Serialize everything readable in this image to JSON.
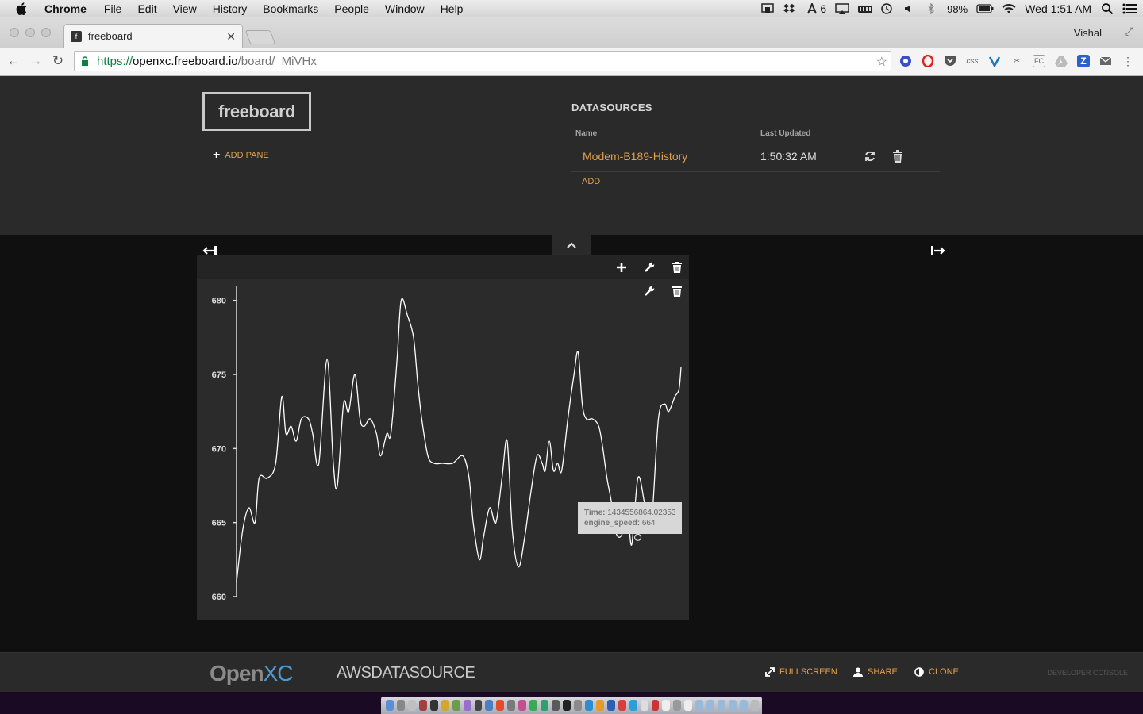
{
  "menubar": {
    "app": "Chrome",
    "items": [
      "File",
      "Edit",
      "View",
      "History",
      "Bookmarks",
      "People",
      "Window",
      "Help"
    ],
    "status_icons": [
      "dropbox-icon",
      "acrobat-icon",
      "airplay-icon",
      "battery-icon",
      "timemachine-icon",
      "volume-icon",
      "bluetooth-icon"
    ],
    "acrobat_count": "6",
    "battery_percent": "98%",
    "clock": "Wed 1:51 AM"
  },
  "browser": {
    "tab_title": "freeboard",
    "profile": "Vishal",
    "url_scheme": "https://",
    "url_host": "openxc.freeboard.io",
    "url_path": "/board/_MiVHx"
  },
  "header": {
    "logo": "freeboard",
    "add_pane": "ADD PANE",
    "datasources_title": "DATASOURCES",
    "col_name": "Name",
    "col_updated": "Last Updated",
    "datasource": {
      "name": "Modem-B189-History",
      "last_updated": "1:50:32 AM"
    },
    "add": "ADD"
  },
  "chart_data": {
    "type": "line",
    "series": [
      {
        "values": [
          [
            0,
            661
          ],
          [
            6,
            664.5
          ],
          [
            12,
            666
          ],
          [
            18,
            665
          ],
          [
            22,
            668
          ],
          [
            30,
            668
          ],
          [
            38,
            669
          ],
          [
            44,
            673.5
          ],
          [
            48,
            671
          ],
          [
            53,
            671.5
          ],
          [
            58,
            670.5
          ],
          [
            63,
            672
          ],
          [
            70,
            672
          ],
          [
            74,
            671
          ],
          [
            80,
            669
          ],
          [
            88,
            676
          ],
          [
            94,
            669
          ],
          [
            98,
            667.5
          ],
          [
            104,
            673
          ],
          [
            109,
            672.5
          ],
          [
            115,
            675
          ],
          [
            120,
            672
          ],
          [
            124,
            671.5
          ],
          [
            130,
            672
          ],
          [
            136,
            671
          ],
          [
            140,
            669.5
          ],
          [
            146,
            671
          ],
          [
            150,
            671
          ],
          [
            156,
            676
          ],
          [
            160,
            680
          ],
          [
            166,
            679
          ],
          [
            172,
            677.5
          ],
          [
            176,
            674.5
          ],
          [
            180,
            672
          ],
          [
            186,
            669.5
          ],
          [
            192,
            669
          ],
          [
            200,
            669
          ],
          [
            210,
            669
          ],
          [
            220,
            669.5
          ],
          [
            226,
            668
          ],
          [
            230,
            665
          ],
          [
            236,
            662.5
          ],
          [
            240,
            664
          ],
          [
            246,
            666
          ],
          [
            252,
            665
          ],
          [
            258,
            668
          ],
          [
            263,
            670.5
          ],
          [
            268,
            664.5
          ],
          [
            274,
            662
          ],
          [
            280,
            664
          ],
          [
            286,
            667
          ],
          [
            292,
            669.5
          ],
          [
            297,
            669
          ],
          [
            300,
            668.5
          ],
          [
            304,
            670.5
          ],
          [
            308,
            668.5
          ],
          [
            312,
            669
          ],
          [
            316,
            668.5
          ],
          [
            322,
            672
          ],
          [
            328,
            675
          ],
          [
            332,
            676.5
          ],
          [
            336,
            673
          ],
          [
            340,
            672
          ],
          [
            346,
            672
          ],
          [
            352,
            671.5
          ],
          [
            356,
            670
          ],
          [
            360,
            668
          ],
          [
            364,
            666.5
          ],
          [
            368,
            664.5
          ],
          [
            372,
            664
          ],
          [
            376,
            664.5
          ],
          [
            380,
            666
          ],
          [
            384,
            663.5
          ],
          [
            390,
            668
          ],
          [
            396,
            666.5
          ],
          [
            400,
            664.5
          ],
          [
            404,
            665.5
          ],
          [
            410,
            672
          ],
          [
            416,
            673
          ],
          [
            420,
            672.5
          ],
          [
            426,
            673.5
          ],
          [
            430,
            674
          ],
          [
            432,
            675.5
          ]
        ]
      }
    ],
    "xlim": [
      0,
      432
    ],
    "ylim": [
      660,
      681
    ],
    "yticks": [
      660,
      665,
      670,
      675,
      680
    ],
    "highlight": {
      "time": "1434556864.02353",
      "engine_speed": "664"
    }
  },
  "tooltip": {
    "time_label": "Time:",
    "time_value": "1434556864.02353",
    "speed_label": "engine_speed:",
    "speed_value": "664"
  },
  "footer": {
    "brand_open": "Open",
    "brand_xc": "XC",
    "board_name": "AWSDATASOURCE",
    "fullscreen": "FULLSCREEN",
    "share": "SHARE",
    "clone": "CLONE",
    "developer_console": "DEVELOPER CONSOLE"
  },
  "colors": {
    "accent": "#e0a04d",
    "header_bg": "#2a2a2a",
    "board_bg": "#101010",
    "pane_bg": "#2b2b2b",
    "line": "#ffffff"
  }
}
